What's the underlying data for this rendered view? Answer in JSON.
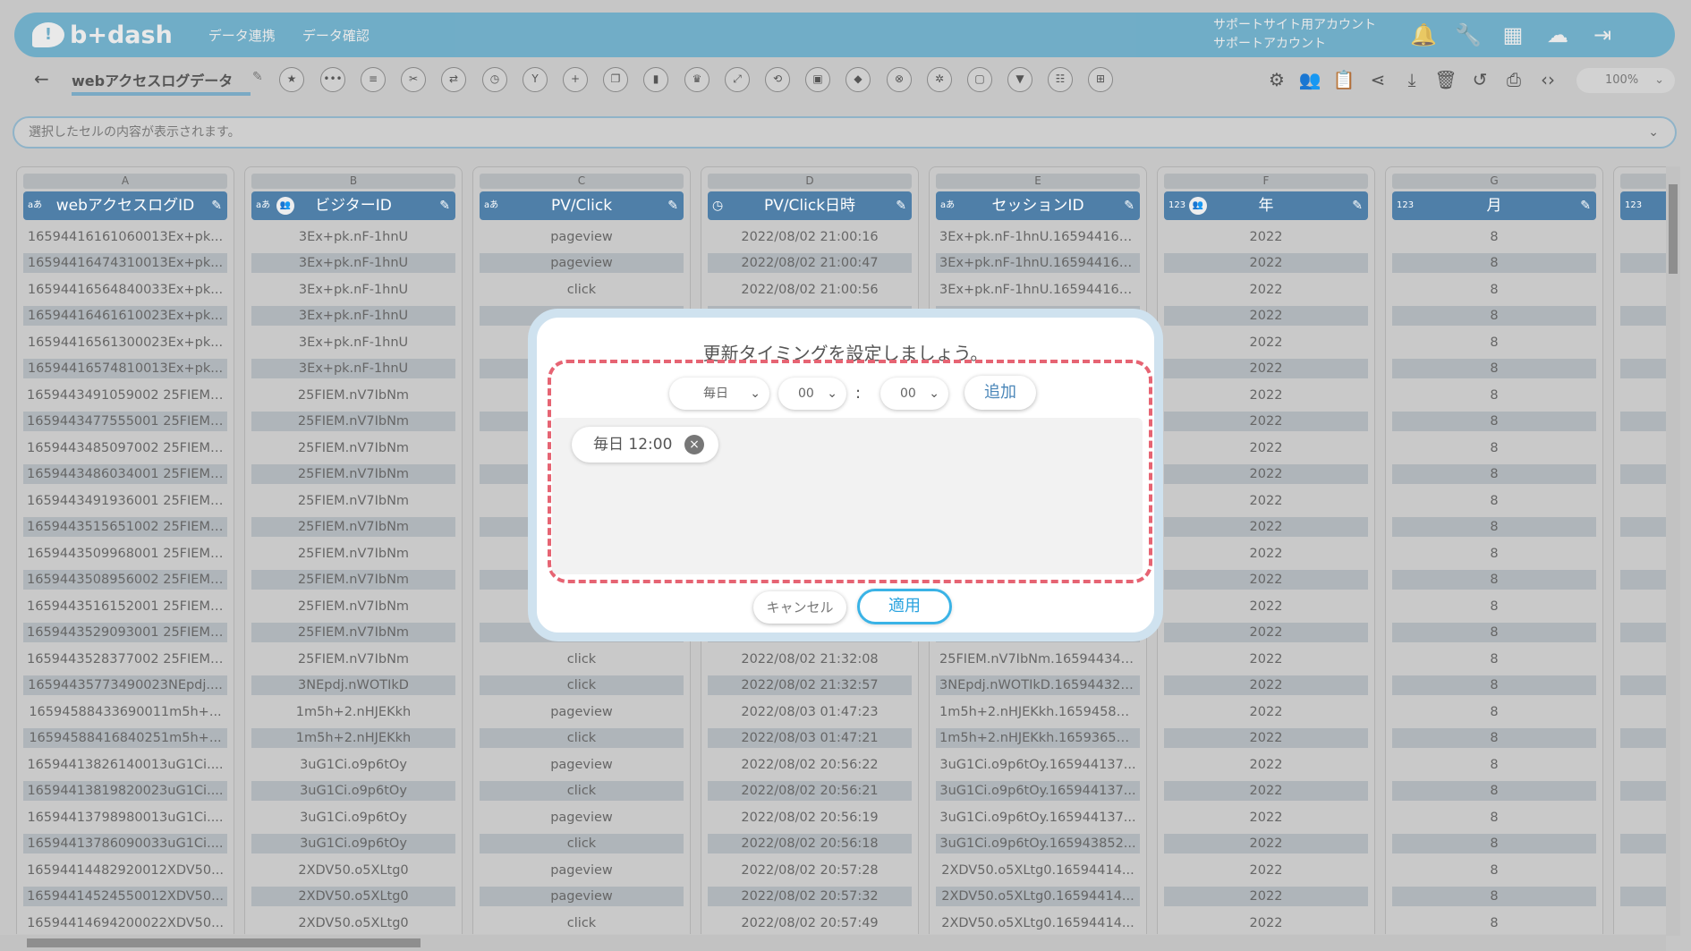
{
  "header": {
    "logo_text": "b+dash",
    "nav": [
      "データ連携",
      "データ確認"
    ],
    "account_line1": "サポートサイト用アカウント",
    "account_line2": "サポートアカウント"
  },
  "toolbar": {
    "sheet_name": "webアクセスログデータ",
    "zoom": "100%"
  },
  "formula_bar": {
    "placeholder": "選択したセルの内容が表示されます。"
  },
  "grid": {
    "columns": [
      {
        "letter": "A",
        "type": "aあ",
        "name": "webアクセスログID"
      },
      {
        "letter": "B",
        "type": "aあ",
        "name": "ビジターID"
      },
      {
        "letter": "C",
        "type": "aあ",
        "name": "PV/Click"
      },
      {
        "letter": "D",
        "type": "clock",
        "name": "PV/Click日時"
      },
      {
        "letter": "E",
        "type": "aあ",
        "name": "セッションID"
      },
      {
        "letter": "F",
        "type": "123",
        "name": "年"
      },
      {
        "letter": "G",
        "type": "123",
        "name": "月"
      },
      {
        "letter": "",
        "type": "123",
        "name": ""
      }
    ],
    "col_a": [
      "16594416161060013Ex+pk...",
      "16594416474310013Ex+pk...",
      "16594416564840033Ex+pk...",
      "16594416461610023Ex+pk...",
      "16594416561300023Ex+pk...",
      "16594416574810013Ex+pk...",
      "1659443491059002 25FIEM....",
      "1659443477555001 25FIEM....",
      "1659443485097002 25FIEM....",
      "1659443486034001 25FIEM....",
      "1659443491936001 25FIEM....",
      "1659443515651002 25FIEM....",
      "1659443509968001 25FIEM....",
      "1659443508956002 25FIEM....",
      "1659443516152001 25FIEM....",
      "1659443529093001 25FIEM....",
      "1659443528377002 25FIEM....",
      "16594435773490023NEpdj....",
      "16594588433690011m5h+...",
      "16594588416840251m5h+...",
      "16594413826140013uG1Ci....",
      "16594413819820023uG1Ci....",
      "16594413798980013uG1Ci....",
      "16594413786090033uG1Ci....",
      "16594414482920012XDV50...",
      "16594414524550012XDV50...",
      "16594414694200022XDV50..."
    ],
    "col_b": [
      "3Ex+pk.nF-1hnU",
      "3Ex+pk.nF-1hnU",
      "3Ex+pk.nF-1hnU",
      "3Ex+pk.nF-1hnU",
      "3Ex+pk.nF-1hnU",
      "3Ex+pk.nF-1hnU",
      "25FIEM.nV7IbNm",
      "25FIEM.nV7IbNm",
      "25FIEM.nV7IbNm",
      "25FIEM.nV7IbNm",
      "25FIEM.nV7IbNm",
      "25FIEM.nV7IbNm",
      "25FIEM.nV7IbNm",
      "25FIEM.nV7IbNm",
      "25FIEM.nV7IbNm",
      "25FIEM.nV7IbNm",
      "25FIEM.nV7IbNm",
      "3NEpdj.nWOTIkD",
      "1m5h+2.nHJEKkh",
      "1m5h+2.nHJEKkh",
      "3uG1Ci.o9p6tOy",
      "3uG1Ci.o9p6tOy",
      "3uG1Ci.o9p6tOy",
      "3uG1Ci.o9p6tOy",
      "2XDV50.o5XLtg0",
      "2XDV50.o5XLtg0",
      "2XDV50.o5XLtg0"
    ],
    "col_c": [
      "pageview",
      "pageview",
      "click",
      "",
      "",
      "",
      "",
      "",
      "",
      "",
      "",
      "",
      "",
      "",
      "",
      "",
      "click",
      "click",
      "pageview",
      "click",
      "pageview",
      "click",
      "pageview",
      "click",
      "pageview",
      "pageview",
      "click"
    ],
    "col_d": [
      "2022/08/02 21:00:16",
      "2022/08/02 21:00:47",
      "2022/08/02 21:00:56",
      "",
      "",
      "",
      "",
      "",
      "",
      "",
      "",
      "",
      "",
      "",
      "",
      "",
      "2022/08/02 21:32:08",
      "2022/08/02 21:32:57",
      "2022/08/03 01:47:23",
      "2022/08/03 01:47:21",
      "2022/08/02 20:56:22",
      "2022/08/02 20:56:21",
      "2022/08/02 20:56:19",
      "2022/08/02 20:56:18",
      "2022/08/02 20:57:28",
      "2022/08/02 20:57:32",
      "2022/08/02 20:57:49"
    ],
    "col_e": [
      "3Ex+pk.nF-1hnU.165944160...",
      "3Ex+pk.nF-1hnU.165944160...",
      "3Ex+pk.nF-1hnU.165944160...",
      "",
      "",
      "",
      "",
      "",
      "",
      "",
      "",
      "",
      "",
      "",
      "",
      "",
      "25FIEM.nV7IbNm.165944347...",
      "3NEpdj.nWOTIkD.165944320...",
      "1m5h+2.nHJEKkh.16594588...",
      "1m5h+2.nHJEKkh.16593657...",
      "3uG1Ci.o9p6tOy.165944137...",
      "3uG1Ci.o9p6tOy.165944137...",
      "3uG1Ci.o9p6tOy.165944137...",
      "3uG1Ci.o9p6tOy.165943852...",
      "2XDV50.o5XLtg0.16594414...",
      "2XDV50.o5XLtg0.16594414...",
      "2XDV50.o5XLtg0.16594414..."
    ],
    "year_value": "2022",
    "month_value": "8"
  },
  "modal": {
    "title": "更新タイミングを設定しましょう。",
    "frequency": "毎日",
    "hour": "00",
    "colon": ":",
    "minute": "00",
    "add_label": "追加",
    "schedule_item": "毎日 12:00",
    "cancel_label": "キャンセル",
    "apply_label": "適用"
  },
  "colors": {
    "header_bg": "#3d9ec8",
    "column_header_bg": "#4f7fa8",
    "highlight_dashed": "#e66473",
    "apply_border": "#3ab3e6"
  }
}
